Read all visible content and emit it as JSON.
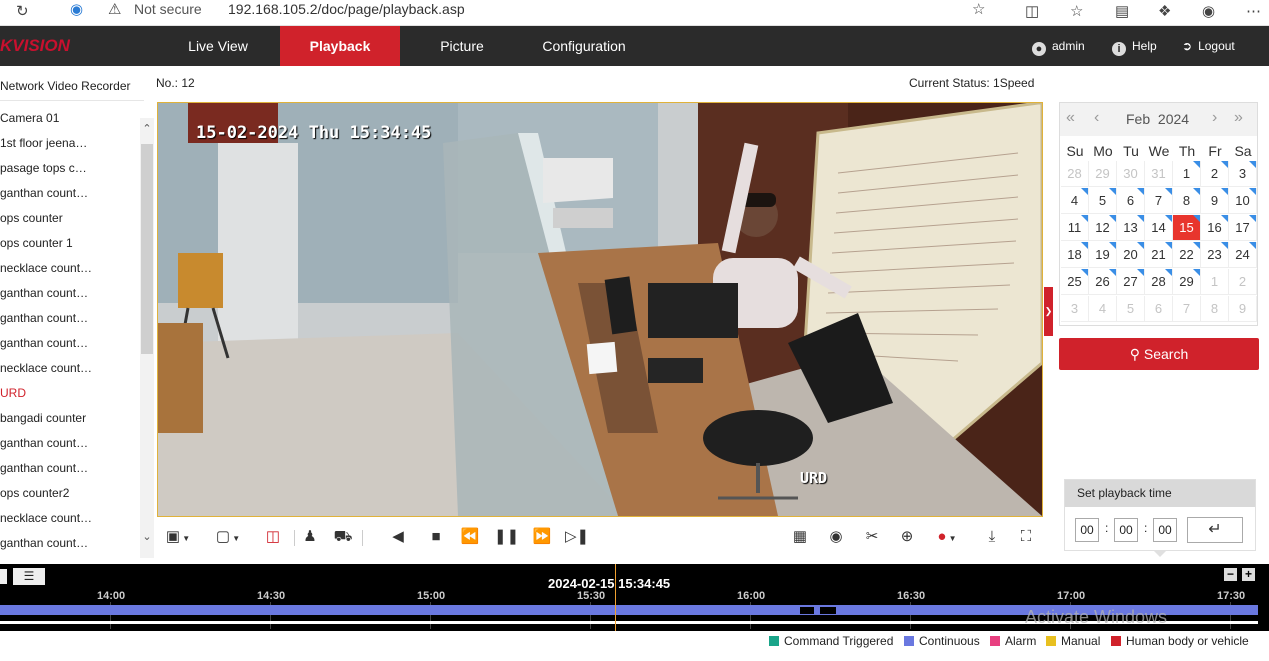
{
  "browser": {
    "security": "Not secure",
    "url": "192.168.105.2/doc/page/playback.asp"
  },
  "nav": {
    "logo": "KVISION",
    "tabs": [
      "Live View",
      "Playback",
      "Picture",
      "Configuration"
    ],
    "active_tab": "Playback",
    "user": "admin",
    "help": "Help",
    "logout": "Logout"
  },
  "left": {
    "title": "Network Video Recorder",
    "cameras": [
      "Camera 01",
      "1st floor jeena…",
      "pasage tops c…",
      "ganthan count…",
      "ops counter",
      "ops counter 1",
      "necklace count…",
      "ganthan count…",
      "ganthan count…",
      "ganthan count…",
      "necklace count…",
      "URD",
      "bangadi counter",
      "ganthan count…",
      "ganthan count…",
      "ops counter2",
      "necklace count…",
      "ganthan count…"
    ],
    "highlighted_camera": "URD"
  },
  "info": {
    "no": "No.: 12",
    "status": "Current Status: 1Speed"
  },
  "video": {
    "osd_time": "15-02-2024 Thu 15:34:45",
    "osd_name": "URD"
  },
  "calendar": {
    "month": "Feb",
    "year": "2024",
    "weekdays": [
      "Su",
      "Mo",
      "Tu",
      "We",
      "Th",
      "Fr",
      "Sa"
    ],
    "days": [
      [
        "28",
        "29",
        "30",
        "31",
        "1",
        "2",
        "3"
      ],
      [
        "4",
        "5",
        "6",
        "7",
        "8",
        "9",
        "10"
      ],
      [
        "11",
        "12",
        "13",
        "14",
        "15",
        "16",
        "17"
      ],
      [
        "18",
        "19",
        "20",
        "21",
        "22",
        "23",
        "24"
      ],
      [
        "25",
        "26",
        "27",
        "28",
        "29",
        "1",
        "2"
      ],
      [
        "3",
        "4",
        "5",
        "6",
        "7",
        "8",
        "9"
      ]
    ],
    "selected_day": "15",
    "days_with_recordings": [
      "1",
      "2",
      "3",
      "4",
      "5",
      "6",
      "7",
      "8",
      "9",
      "10",
      "11",
      "12",
      "13",
      "14",
      "15",
      "16",
      "17",
      "18",
      "19",
      "20",
      "21",
      "22",
      "23",
      "24",
      "25",
      "26",
      "27",
      "28",
      "29"
    ],
    "search_label": "Search"
  },
  "playback_time": {
    "title": "Set playback time",
    "hh": "00",
    "mm": "00",
    "ss": "00",
    "sep": ":"
  },
  "timeline": {
    "current": "2024-02-15 15:34:45",
    "ticks": [
      "14:00",
      "14:30",
      "15:00",
      "15:30",
      "16:00",
      "16:30",
      "17:00",
      "17:30"
    ],
    "colors": {
      "continuous": "#6a78e0",
      "cursor": "#f0a030"
    }
  },
  "legend": [
    {
      "label": "Command Triggered",
      "color": "#1aa58a"
    },
    {
      "label": "Continuous",
      "color": "#6a78e0"
    },
    {
      "label": "Alarm",
      "color": "#e84080"
    },
    {
      "label": "Manual",
      "color": "#e8c020"
    },
    {
      "label": "Human body or vehicle",
      "color": "#d0222b"
    }
  ],
  "watermark": "Activate Windows"
}
